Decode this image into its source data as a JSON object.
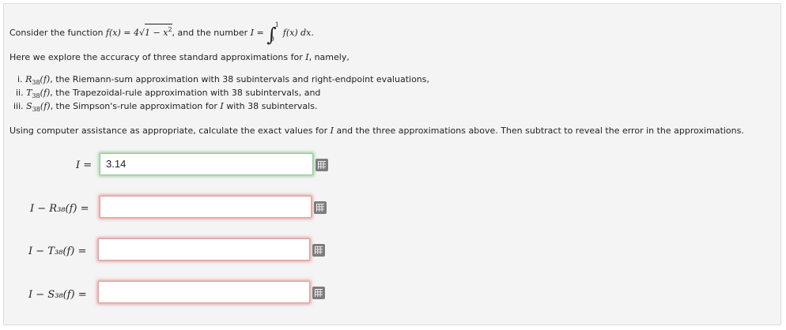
{
  "intro": {
    "consider": "Consider the function",
    "func": {
      "lhs": "f(x) = 4",
      "rad": "1 − x",
      "exp": "2"
    },
    "and_number": ", and the number",
    "I_eq": "I = ",
    "integrand": "f(x) dx",
    "lower": "0",
    "upper": "1",
    "period": "."
  },
  "explore": {
    "pre": "Here we explore the accuracy of three standard approximations for",
    "var": "I",
    "post": ", namely,"
  },
  "items": [
    {
      "num": "i.",
      "sym": "R",
      "n": "38",
      "arg": "(f)",
      "text": ", the Riemann-sum approximation with 38 subintervals and right-endpoint evaluations,"
    },
    {
      "num": "ii.",
      "sym": "T",
      "n": "38",
      "arg": "(f)",
      "text": ", the Trapezoidal-rule approximation with 38 subintervals, and"
    },
    {
      "num": "iii.",
      "sym": "S",
      "n": "38",
      "arg": "(f)",
      "text_pre": ", the Simpson's-rule approximation for",
      "var": "I",
      "text_post": "with 38 subintervals."
    }
  ],
  "instructions": {
    "pre": "Using computer assistance as appropriate, calculate the exact values for",
    "var": "I",
    "post": "and the three approximations above. Then subtract to reveal the error in the approximations."
  },
  "answers": [
    {
      "label": "I =",
      "value": "3.14"
    },
    {
      "label": "I − R₃₈(f) =",
      "value": ""
    },
    {
      "label": "I − T₃₈(f) =",
      "value": ""
    },
    {
      "label": "I − S₃₈(f) =",
      "value": ""
    }
  ]
}
